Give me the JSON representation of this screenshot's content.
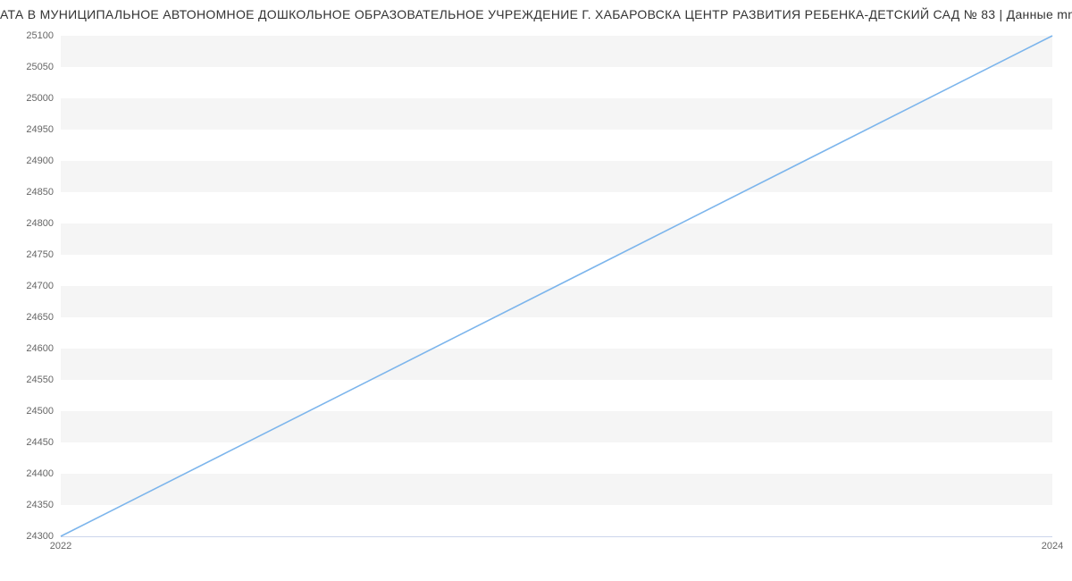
{
  "chart_data": {
    "type": "line",
    "title": "АТА В МУНИЦИПАЛЬНОЕ АВТОНОМНОЕ ДОШКОЛЬНОЕ ОБРАЗОВАТЕЛЬНОЕ УЧРЕЖДЕНИЕ Г. ХАБАРОВСКА ЦЕНТР РАЗВИТИЯ РЕБЕНКА-ДЕТСКИЙ САД № 83 | Данные mnogo",
    "x": [
      2022,
      2024
    ],
    "values": [
      24300,
      25100
    ],
    "xlabel": "",
    "ylabel": "",
    "xlim": [
      2022,
      2024
    ],
    "ylim": [
      24300,
      25100
    ],
    "y_ticks": [
      24300,
      24350,
      24400,
      24450,
      24500,
      24550,
      24600,
      24650,
      24700,
      24750,
      24800,
      24850,
      24900,
      24950,
      25000,
      25050,
      25100
    ],
    "x_ticks": [
      2022,
      2024
    ],
    "line_color": "#7cb5ec"
  }
}
